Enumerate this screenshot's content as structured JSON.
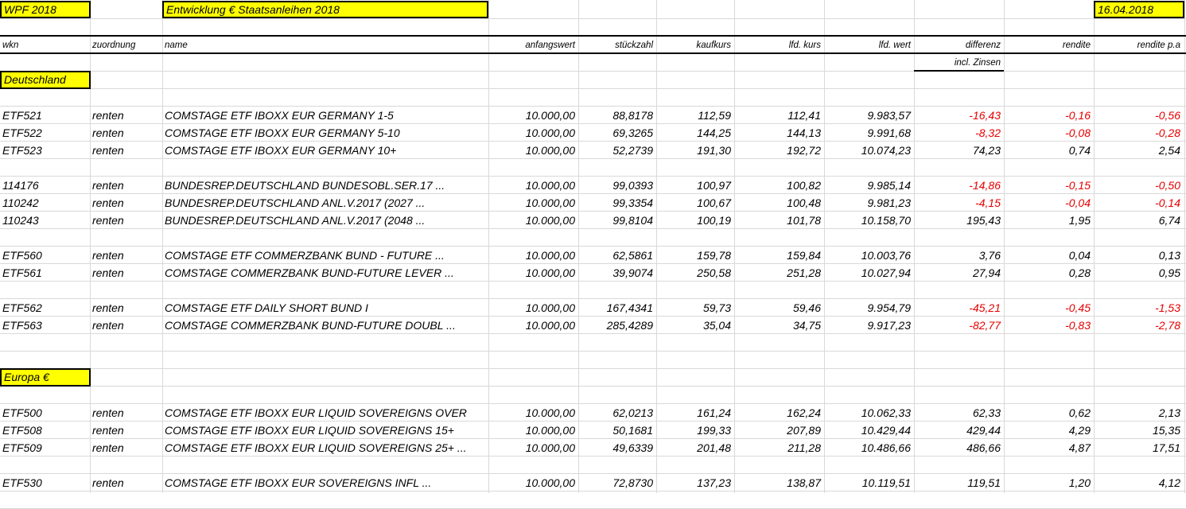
{
  "sheet": {
    "title_left": "WPF 2018",
    "title_main": "Entwicklung € Staatsanleihen 2018",
    "date": "16.04.2018"
  },
  "headers": {
    "wkn": "wkn",
    "zuordnung": "zuordnung",
    "name": "name",
    "anfangswert": "anfangswert",
    "stueckzahl": "stückzahl",
    "kaufkurs": "kaufkurs",
    "lfd_kurs": "lfd. kurs",
    "lfd_wert": "lfd. wert",
    "differenz": "differenz",
    "rendite": "rendite",
    "rendite_pa": "rendite p.a",
    "differenz_note": "incl. Zinsen"
  },
  "sections": {
    "deutschland": "Deutschland",
    "europa": "Europa €"
  },
  "rows": [
    {
      "wkn": "ETF521",
      "z": "renten",
      "name": "COMSTAGE ETF IBOXX EUR GERMANY 1-5",
      "aw": "10.000,00",
      "sz": "88,8178",
      "kk": "112,59",
      "lk": "112,41",
      "lw": "9.983,57",
      "diff": "-16,43",
      "rend": "-0,16",
      "rpa": "-0,56",
      "neg": true
    },
    {
      "wkn": "ETF522",
      "z": "renten",
      "name": "COMSTAGE ETF IBOXX EUR GERMANY 5-10",
      "aw": "10.000,00",
      "sz": "69,3265",
      "kk": "144,25",
      "lk": "144,13",
      "lw": "9.991,68",
      "diff": "-8,32",
      "rend": "-0,08",
      "rpa": "-0,28",
      "neg": true
    },
    {
      "wkn": "ETF523",
      "z": "renten",
      "name": "COMSTAGE ETF IBOXX EUR GERMANY 10+",
      "aw": "10.000,00",
      "sz": "52,2739",
      "kk": "191,30",
      "lk": "192,72",
      "lw": "10.074,23",
      "diff": "74,23",
      "rend": "0,74",
      "rpa": "2,54",
      "neg": false
    },
    {
      "wkn": "114176",
      "z": "renten",
      "name": "BUNDESREP.DEUTSCHLAND BUNDESOBL.SER.17 ...",
      "aw": "10.000,00",
      "sz": "99,0393",
      "kk": "100,97",
      "lk": "100,82",
      "lw": "9.985,14",
      "diff": "-14,86",
      "rend": "-0,15",
      "rpa": "-0,50",
      "neg": true
    },
    {
      "wkn": "110242",
      "z": "renten",
      "name": "BUNDESREP.DEUTSCHLAND ANL.V.2017 (2027 ...",
      "aw": "10.000,00",
      "sz": "99,3354",
      "kk": "100,67",
      "lk": "100,48",
      "lw": "9.981,23",
      "diff": "-4,15",
      "rend": "-0,04",
      "rpa": "-0,14",
      "neg": true
    },
    {
      "wkn": "110243",
      "z": "renten",
      "name": "BUNDESREP.DEUTSCHLAND ANL.V.2017 (2048 ...",
      "aw": "10.000,00",
      "sz": "99,8104",
      "kk": "100,19",
      "lk": "101,78",
      "lw": "10.158,70",
      "diff": "195,43",
      "rend": "1,95",
      "rpa": "6,74",
      "neg": false
    },
    {
      "wkn": "ETF560",
      "z": "renten",
      "name": "COMSTAGE ETF COMMERZBANK BUND - FUTURE ...",
      "aw": "10.000,00",
      "sz": "62,5861",
      "kk": "159,78",
      "lk": "159,84",
      "lw": "10.003,76",
      "diff": "3,76",
      "rend": "0,04",
      "rpa": "0,13",
      "neg": false
    },
    {
      "wkn": "ETF561",
      "z": "renten",
      "name": "COMSTAGE COMMERZBANK BUND-FUTURE LEVER ...",
      "aw": "10.000,00",
      "sz": "39,9074",
      "kk": "250,58",
      "lk": "251,28",
      "lw": "10.027,94",
      "diff": "27,94",
      "rend": "0,28",
      "rpa": "0,95",
      "neg": false
    },
    {
      "wkn": "ETF562",
      "z": "renten",
      "name": "COMSTAGE ETF DAILY SHORT BUND I",
      "aw": "10.000,00",
      "sz": "167,4341",
      "kk": "59,73",
      "lk": "59,46",
      "lw": "9.954,79",
      "diff": "-45,21",
      "rend": "-0,45",
      "rpa": "-1,53",
      "neg": true
    },
    {
      "wkn": "ETF563",
      "z": "renten",
      "name": "COMSTAGE COMMERZBANK BUND-FUTURE DOUBL ...",
      "aw": "10.000,00",
      "sz": "285,4289",
      "kk": "35,04",
      "lk": "34,75",
      "lw": "9.917,23",
      "diff": "-82,77",
      "rend": "-0,83",
      "rpa": "-2,78",
      "neg": true
    },
    {
      "wkn": "ETF500",
      "z": "renten",
      "name": "COMSTAGE ETF IBOXX EUR LIQUID SOVEREIGNS OVER",
      "aw": "10.000,00",
      "sz": "62,0213",
      "kk": "161,24",
      "lk": "162,24",
      "lw": "10.062,33",
      "diff": "62,33",
      "rend": "0,62",
      "rpa": "2,13",
      "neg": false
    },
    {
      "wkn": "ETF508",
      "z": "renten",
      "name": "COMSTAGE ETF IBOXX EUR LIQUID SOVEREIGNS 15+",
      "aw": "10.000,00",
      "sz": "50,1681",
      "kk": "199,33",
      "lk": "207,89",
      "lw": "10.429,44",
      "diff": "429,44",
      "rend": "4,29",
      "rpa": "15,35",
      "neg": false
    },
    {
      "wkn": "ETF509",
      "z": "renten",
      "name": "COMSTAGE ETF IBOXX EUR LIQUID SOVEREIGNS 25+ ...",
      "aw": "10.000,00",
      "sz": "49,6339",
      "kk": "201,48",
      "lk": "211,28",
      "lw": "10.486,66",
      "diff": "486,66",
      "rend": "4,87",
      "rpa": "17,51",
      "neg": false
    },
    {
      "wkn": "ETF530",
      "z": "renten",
      "name": "COMSTAGE ETF IBOXX EUR SOVEREIGNS INFL ...",
      "aw": "10.000,00",
      "sz": "72,8730",
      "kk": "137,23",
      "lk": "138,87",
      "lw": "10.119,51",
      "diff": "119,51",
      "rend": "1,20",
      "rpa": "4,12",
      "neg": false
    }
  ]
}
